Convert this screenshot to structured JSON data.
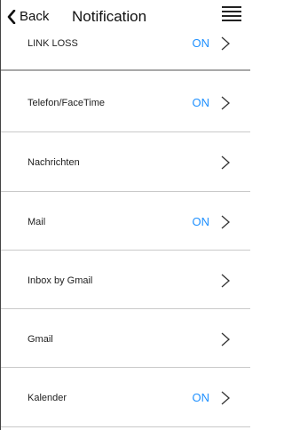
{
  "header": {
    "back_label": "Back",
    "title": "Notification"
  },
  "colors": {
    "status_on": "#1e90ff",
    "divider": "#c9c9c9"
  },
  "rows": [
    {
      "label": "LINK LOSS",
      "status": "ON"
    },
    {
      "label": "Telefon/FaceTime",
      "status": "ON"
    },
    {
      "label": "Nachrichten",
      "status": ""
    },
    {
      "label": "Mail",
      "status": "ON"
    },
    {
      "label": "Inbox by Gmail",
      "status": ""
    },
    {
      "label": "Gmail",
      "status": ""
    },
    {
      "label": "Kalender",
      "status": "ON"
    }
  ]
}
